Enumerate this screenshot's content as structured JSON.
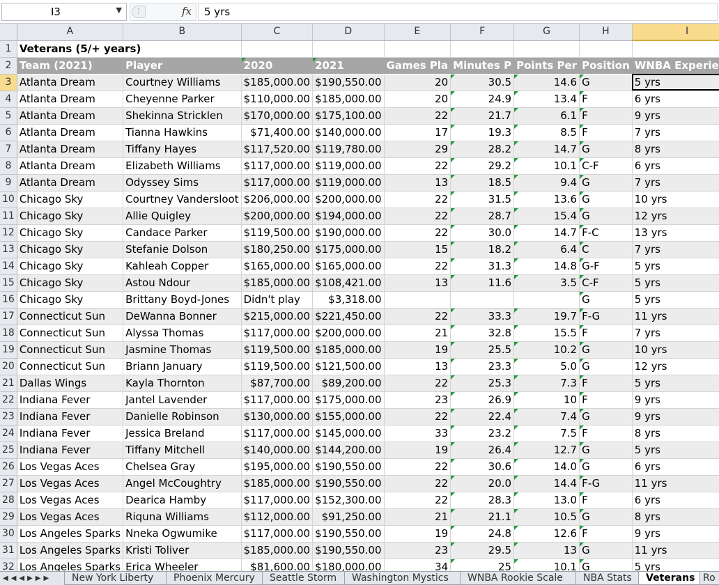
{
  "formula_bar": {
    "name_box": "I3",
    "fx_label": "fx",
    "formula": "5 yrs"
  },
  "columns": [
    "A",
    "B",
    "C",
    "D",
    "E",
    "F",
    "G",
    "H",
    "I"
  ],
  "active_col": "I",
  "active_row": 3,
  "title": "Veterans (5/+ years)",
  "headers": [
    "Team (2021)",
    "Player",
    "2020",
    "2021",
    "Games Pla",
    "Minutes P",
    "Points Per",
    "Position",
    "WNBA Experience"
  ],
  "rows": [
    [
      "Atlanta Dream",
      "Courtney Williams",
      "$185,000.00",
      "$190,550.00",
      "20",
      "30.5",
      "14.6",
      "G",
      "5 yrs"
    ],
    [
      "Atlanta Dream",
      "Cheyenne Parker",
      "$110,000.00",
      "$185,000.00",
      "20",
      "24.9",
      "13.4",
      "F",
      "6 yrs"
    ],
    [
      "Atlanta Dream",
      "Shekinna Stricklen",
      "$170,000.00",
      "$175,100.00",
      "22",
      "21.7",
      "6.1",
      "F",
      "9 yrs"
    ],
    [
      "Atlanta Dream",
      "Tianna Hawkins",
      "$71,400.00",
      "$140,000.00",
      "17",
      "19.3",
      "8.5",
      "F",
      "7 yrs"
    ],
    [
      "Atlanta Dream",
      "Tiffany Hayes",
      "$117,520.00",
      "$119,780.00",
      "29",
      "28.2",
      "14.7",
      "G",
      "8 yrs"
    ],
    [
      "Atlanta Dream",
      "Elizabeth Williams",
      "$117,000.00",
      "$119,000.00",
      "22",
      "29.2",
      "10.1",
      "C-F",
      "6 yrs"
    ],
    [
      "Atlanta Dream",
      "Odyssey Sims",
      "$117,000.00",
      "$119,000.00",
      "13",
      "18.5",
      "9.4",
      "G",
      "7 yrs"
    ],
    [
      "Chicago Sky",
      "Courtney Vandersloot",
      "$206,000.00",
      "$200,000.00",
      "22",
      "31.5",
      "13.6",
      "G",
      "10 yrs"
    ],
    [
      "Chicago Sky",
      "Allie Quigley",
      "$200,000.00",
      "$194,000.00",
      "22",
      "28.7",
      "15.4",
      "G",
      "12 yrs"
    ],
    [
      "Chicago Sky",
      "Candace Parker",
      "$119,500.00",
      "$190,000.00",
      "22",
      "30.0",
      "14.7",
      "F-C",
      "13 yrs"
    ],
    [
      "Chicago Sky",
      "Stefanie Dolson",
      "$180,250.00",
      "$175,000.00",
      "15",
      "18.2",
      "6.4",
      "C",
      "7 yrs"
    ],
    [
      "Chicago Sky",
      "Kahleah Copper",
      "$165,000.00",
      "$165,000.00",
      "22",
      "31.3",
      "14.8",
      "G-F",
      "5 yrs"
    ],
    [
      "Chicago Sky",
      "Astou Ndour",
      "$185,000.00",
      "$108,421.00",
      "13",
      "11.6",
      "3.5",
      "C-F",
      "5 yrs"
    ],
    [
      "Chicago Sky",
      "Brittany Boyd-Jones",
      "Didn't play",
      "$3,318.00",
      "",
      "",
      "",
      "G",
      "5 yrs"
    ],
    [
      "Connecticut Sun",
      "DeWanna Bonner",
      "$215,000.00",
      "$221,450.00",
      "22",
      "33.3",
      "19.7",
      "F-G",
      "11 yrs"
    ],
    [
      "Connecticut Sun",
      "Alyssa Thomas",
      "$117,000.00",
      "$200,000.00",
      "21",
      "32.8",
      "15.5",
      "F",
      "7 yrs"
    ],
    [
      "Connecticut Sun",
      "Jasmine Thomas",
      "$119,500.00",
      "$185,000.00",
      "19",
      "25.5",
      "10.2",
      "G",
      "10 yrs"
    ],
    [
      "Connecticut Sun",
      "Briann January",
      "$119,500.00",
      "$121,500.00",
      "13",
      "23.3",
      "5.0",
      "G",
      "12 yrs"
    ],
    [
      "Dallas Wings",
      "Kayla Thornton",
      "$87,700.00",
      "$89,200.00",
      "22",
      "25.3",
      "7.3",
      "F",
      "5 yrs"
    ],
    [
      "Indiana Fever",
      "Jantel Lavender",
      "$117,000.00",
      "$175,000.00",
      "23",
      "26.9",
      "10",
      "F",
      "9 yrs"
    ],
    [
      "Indiana Fever",
      "Danielle Robinson",
      "$130,000.00",
      "$155,000.00",
      "22",
      "22.4",
      "7.4",
      "G",
      "9 yrs"
    ],
    [
      "Indiana Fever",
      "Jessica Breland",
      "$117,000.00",
      "$145,000.00",
      "33",
      "23.2",
      "7.5",
      "F",
      "8 yrs"
    ],
    [
      "Indiana Fever",
      "Tiffany Mitchell",
      "$140,000.00",
      "$144,200.00",
      "19",
      "26.4",
      "12.7",
      "G",
      "5 yrs"
    ],
    [
      "Los Vegas Aces",
      "Chelsea Gray",
      "$195,000.00",
      "$190,550.00",
      "22",
      "30.6",
      "14.0",
      "G",
      "6 yrs"
    ],
    [
      "Los Vegas Aces",
      "Angel McCoughtry",
      "$185,000.00",
      "$190,550.00",
      "22",
      "20.0",
      "14.4",
      "F-G",
      "11 yrs"
    ],
    [
      "Los Vegas Aces",
      "Dearica Hamby",
      "$117,000.00",
      "$152,300.00",
      "22",
      "28.3",
      "13.0",
      "F",
      "6 yrs"
    ],
    [
      "Los Vegas Aces",
      "Riquna Williams",
      "$112,000.00",
      "$91,250.00",
      "21",
      "21.1",
      "10.5",
      "G",
      "8 yrs"
    ],
    [
      "Los Angeles Sparks",
      "Nneka Ogwumike",
      "$117,000.00",
      "$190,550.00",
      "19",
      "24.8",
      "12.6",
      "F",
      "9 yrs"
    ],
    [
      "Los Angeles Sparks",
      "Kristi Toliver",
      "$185,000.00",
      "$190,550.00",
      "23",
      "29.5",
      "13",
      "G",
      "11 yrs"
    ],
    [
      "Los Angeles Sparks",
      "Erica Wheeler",
      "$81,600.00",
      "$180,000.00",
      "34",
      "25",
      "10.1",
      "G",
      "5 yrs"
    ]
  ],
  "sheet_tabs": [
    "New York Liberty",
    "Phoenix Mercury",
    "Seattle Storm",
    "Washington Mystics",
    "WNBA Rookie Scale",
    "NBA Stats",
    "Veterans",
    "Ro"
  ],
  "active_tab": "Veterans",
  "colors": {
    "header_fill": "#a6a6a6",
    "band_fill": "#ececec",
    "active_header": "#f8db8d",
    "comment_marker": "#1e9c3a"
  }
}
